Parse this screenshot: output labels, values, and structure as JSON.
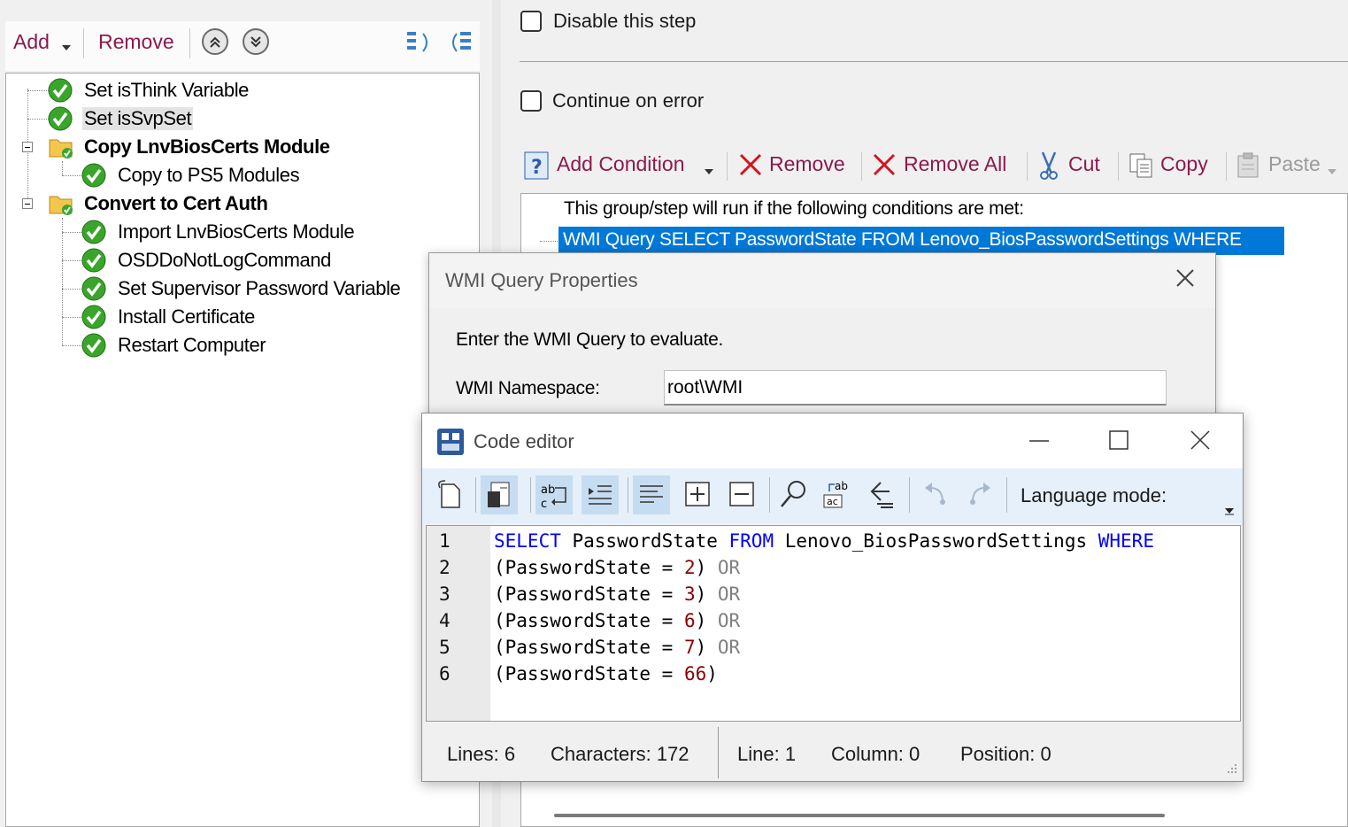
{
  "left_toolbar": {
    "add_label": "Add",
    "remove_label": "Remove"
  },
  "tree": {
    "items": [
      {
        "label": "Set isThink Variable"
      },
      {
        "label": "Set isSvpSet"
      },
      {
        "label": "Copy LnvBiosCerts Module"
      },
      {
        "label": "Copy to PS5 Modules"
      },
      {
        "label": "Convert to Cert Auth"
      },
      {
        "label": "Import LnvBiosCerts Module"
      },
      {
        "label": "OSDDoNotLogCommand"
      },
      {
        "label": "Set Supervisor Password Variable"
      },
      {
        "label": "Install Certificate"
      },
      {
        "label": "Restart Computer"
      }
    ]
  },
  "step_options": {
    "disable_label": "Disable this step",
    "continue_label": "Continue on error"
  },
  "condition_toolbar": {
    "add_condition": "Add Condition",
    "remove": "Remove",
    "remove_all": "Remove All",
    "cut": "Cut",
    "copy": "Copy",
    "paste": "Paste"
  },
  "conditions": {
    "header": "This group/step will run if the following conditions are met:",
    "item": "WMI Query  SELECT PasswordState FROM Lenovo_BiosPasswordSettings WHERE"
  },
  "wmi_dialog": {
    "title": "WMI Query Properties",
    "prompt": "Enter the WMI Query to evaluate.",
    "namespace_label": "WMI Namespace:",
    "namespace_value": "root\\WMI"
  },
  "code_editor": {
    "title": "Code editor",
    "language_mode_label": "Language mode:",
    "line_numbers": [
      "1",
      "2",
      "3",
      "4",
      "5",
      "6"
    ],
    "code": {
      "l1_kw1": "SELECT",
      "l1_id1": " PasswordState ",
      "l1_kw2": "FROM",
      "l1_id2": " Lenovo_BiosPasswordSettings ",
      "l1_kw3": "WHERE",
      "l2_a": "(PasswordState = ",
      "l2_num": "2",
      "l2_b": ") ",
      "l2_op": "OR",
      "l3_a": "(PasswordState = ",
      "l3_num": "3",
      "l3_b": ") ",
      "l3_op": "OR",
      "l4_a": "(PasswordState = ",
      "l4_num": "6",
      "l4_b": ") ",
      "l4_op": "OR",
      "l5_a": "(PasswordState = ",
      "l5_num": "7",
      "l5_b": ") ",
      "l5_op": "OR",
      "l6_a": "(PasswordState = ",
      "l6_num": "66",
      "l6_b": ")"
    },
    "status": {
      "lines": "Lines:  6",
      "characters": "Characters:  172",
      "line": "Line:  1",
      "column": "Column:  0",
      "position": "Position:  0"
    }
  },
  "colors": {
    "accent_link": "#8b1a4e",
    "selection": "#0078d7",
    "keyword": "#0000ff",
    "number": "#8b0000"
  }
}
